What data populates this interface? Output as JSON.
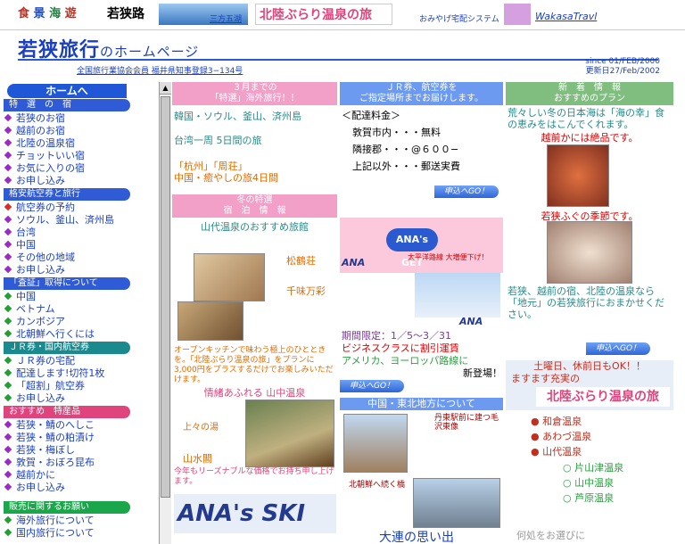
{
  "topbar": {
    "logo_chars": [
      "食",
      "景",
      "海",
      "遊"
    ],
    "region": "若狭路",
    "mikata_label": "三方五湖",
    "onsen_banner": "北陸ぶらり温泉の旅",
    "omiyage_label": "おみやげ宅配システム",
    "wakasa_travel": "WakasaTravl"
  },
  "header": {
    "title_main": "若狭旅行",
    "title_sub": "のホームページ",
    "assoc": "全国旅行業協会会員  福井県知事登録3−134号",
    "since": "since 01/FEB/2000",
    "updated": "更新日27/Feb/2002"
  },
  "sidebar": {
    "home": "ホームへ",
    "sections": [
      {
        "title": "特　選　の　宿",
        "color": "blue",
        "items": [
          "若狭のお宿",
          "越前のお宿",
          "北陸の温泉宿",
          "チョットいい宿",
          "お気に入りの宿",
          "お申し込み"
        ],
        "dot": "dp"
      },
      {
        "title": "格安航空券と旅行",
        "color": "blue",
        "items": [
          "航空券の予約",
          "ソウル、釜山、済州島",
          "台湾",
          "中国",
          "その他の地域",
          "お申し込み"
        ],
        "dot": "dp"
      },
      {
        "title": "「査証」取得について",
        "color": "blue",
        "items": [
          "中国",
          "ベトナム",
          "カンボジア",
          "北朝鮮へ行くには"
        ],
        "dot": "dp"
      },
      {
        "title": "ＪＲ券・国内航空券",
        "color": "teal",
        "items": [
          "ＪＲ券の宅配",
          "配達します!切符1枚",
          "「超割」航空券",
          "お申し込み"
        ],
        "dot": "dg"
      },
      {
        "title": "おすすめ　特産品",
        "color": "pink",
        "items": [
          "若狭・鯖のへしこ",
          "若狭・鯖の粕漬け",
          "若狭・梅ぼし",
          "敦賀・おぼろ昆布",
          "越前かに",
          "お申し込み"
        ],
        "dot": "dp"
      },
      {
        "title": "販売に関するお願い",
        "color": "green",
        "items": [
          "海外旅行について",
          "国内旅行について"
        ],
        "dot": "dg"
      }
    ]
  },
  "col1": {
    "hdr1": "３月までの",
    "hdr2": "「特選」海外旅行！！",
    "lines": [
      "韓国・ソウル、釜山、済州島",
      "台湾一周 5日間の旅",
      "「杭州」「周荘」",
      "中国・癒やしの旅4日間"
    ],
    "winter_hdr1": "冬の特選",
    "winter_hdr2": "宿　泊　情　報",
    "yamashiro": "山代温泉のおすすめ旅館",
    "shoutei": "松鶴荘",
    "senmi": "千味万彩",
    "promo": "オープンキッチンで味わう極上のひとときを。「北陸ぶらり温泉の旅」をプランに3,000円をプラスするだけでお楽しみいただけます。",
    "yamanaka_hdr": "情緒あふれる 山中温泉",
    "uenoyu": "上々の湯",
    "yamamizu": "山水閣",
    "reasonable": "今年もリーズナブルな価格でお持ち申し上げます。",
    "ana_ski": "ANA's SKI"
  },
  "col2": {
    "hdr1": "ＪＲ券、航空券を",
    "hdr2": "ご指定場所までお届けします。",
    "fee_title": "＜配達料金＞",
    "fees": [
      "敦賀市内・・・無料",
      "隣接郡・・・@６００−",
      "上記以外・・・郵送実費"
    ],
    "apply": "申込へGO！",
    "ana_get": "ANA's GET",
    "get_note": "太平洋路線 大増便下げ！",
    "ana1": "ANA",
    "ana2": "ANA",
    "period": "期間限定：1／5〜3／31",
    "business": "ビジネスクラスに割引運賃",
    "usa": "アメリカ、ヨーロッパ路線に",
    "new": "新登場！",
    "china_hdr": "中国・東北地方について",
    "station": "丹東駅前に建つ毛沢東像",
    "bridge": "北朝鮮へ続く橋",
    "dalian": "大連の思い出"
  },
  "col3": {
    "hdr1": "新　着　情　報",
    "hdr2": "おすすめのプラン",
    "intro": "荒々しい冬の日本海は「海の幸」食の恵みをはこんでくれます。",
    "crab": "越前かには絶品です。",
    "fugu": "若狭ふぐの季節です。",
    "desc": "若狭、越前の宿、北陸の温泉なら「地元」の若狭旅行におまかせください。",
    "apply": "申込へGO！",
    "holiday": "土曜日、休前日もOK！！",
    "more": "ますます充実の",
    "onsen": [
      "和倉温泉",
      "あわづ温泉",
      "山代温泉"
    ],
    "subonsen": [
      "片山津温泉",
      "山中温泉",
      "芦原温泉"
    ],
    "choose": "何処をお選びに"
  }
}
